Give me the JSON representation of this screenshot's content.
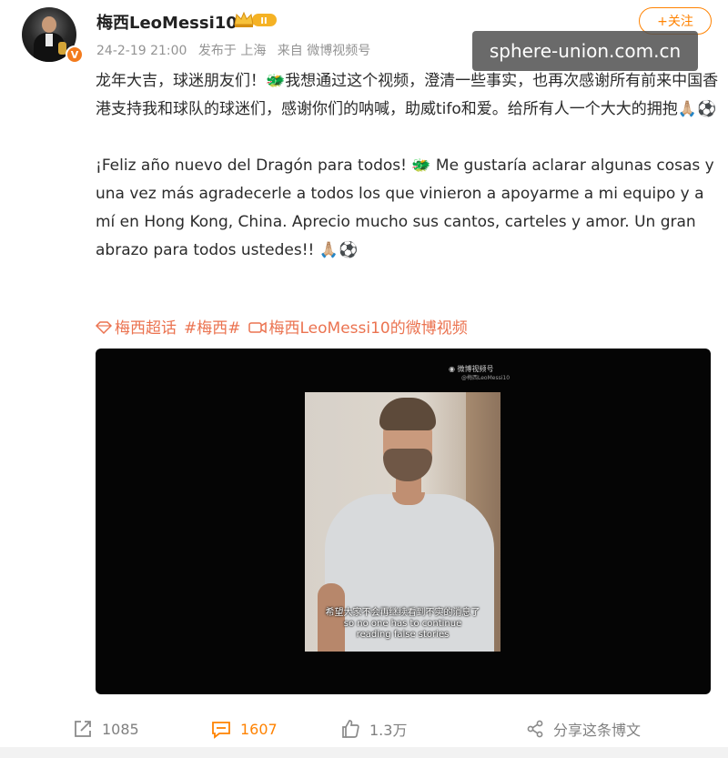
{
  "user": {
    "name": "梅西LeoMessi10",
    "level_badge": "II",
    "verified_badge": "V"
  },
  "post_meta": {
    "date": "24-2-19 21:00",
    "published_from": "发布于 上海",
    "source": "来自 微博视频号"
  },
  "follow_label": "+关注",
  "watermark": "sphere-union.com.cn",
  "text": {
    "cn": "龙年大吉，球迷朋友们！🐲我想通过这个视频，澄清一些事实，也再次感谢所有前来中国香港支持我和球队的球迷们，感谢你们的呐喊，助威tifo和爱。给所有人一个大大的拥抱🙏🏼⚽",
    "es": "¡Feliz año nuevo del Dragón para todos! 🐲 Me gustaría aclarar algunas cosas y una vez más agradecerle a todos los que vinieron a apoyarme a mi equipo y a mí en Hong Kong, China. Aprecio mucho sus cantos, carteles y amor. Un gran abrazo para todos ustedes!! 🙏🏼⚽"
  },
  "tags": {
    "supertopic": "梅西超话",
    "hashtag": "#梅西#",
    "video_link": "梅西LeoMessi10的微博视频"
  },
  "video": {
    "logo": "微博视频号",
    "logo_sub": "@梅西LeoMessi10",
    "subtitle_cn": "希望大家不会再继续看到不实的消息了",
    "subtitle_en1": "so no one has to continue",
    "subtitle_en2": "reading false stories"
  },
  "actions": {
    "repost": "1085",
    "comment": "1607",
    "like": "1.3万",
    "share": "分享这条博文"
  },
  "colors": {
    "accent": "#ff8200",
    "tag": "#eb7350",
    "meta": "#939393"
  }
}
